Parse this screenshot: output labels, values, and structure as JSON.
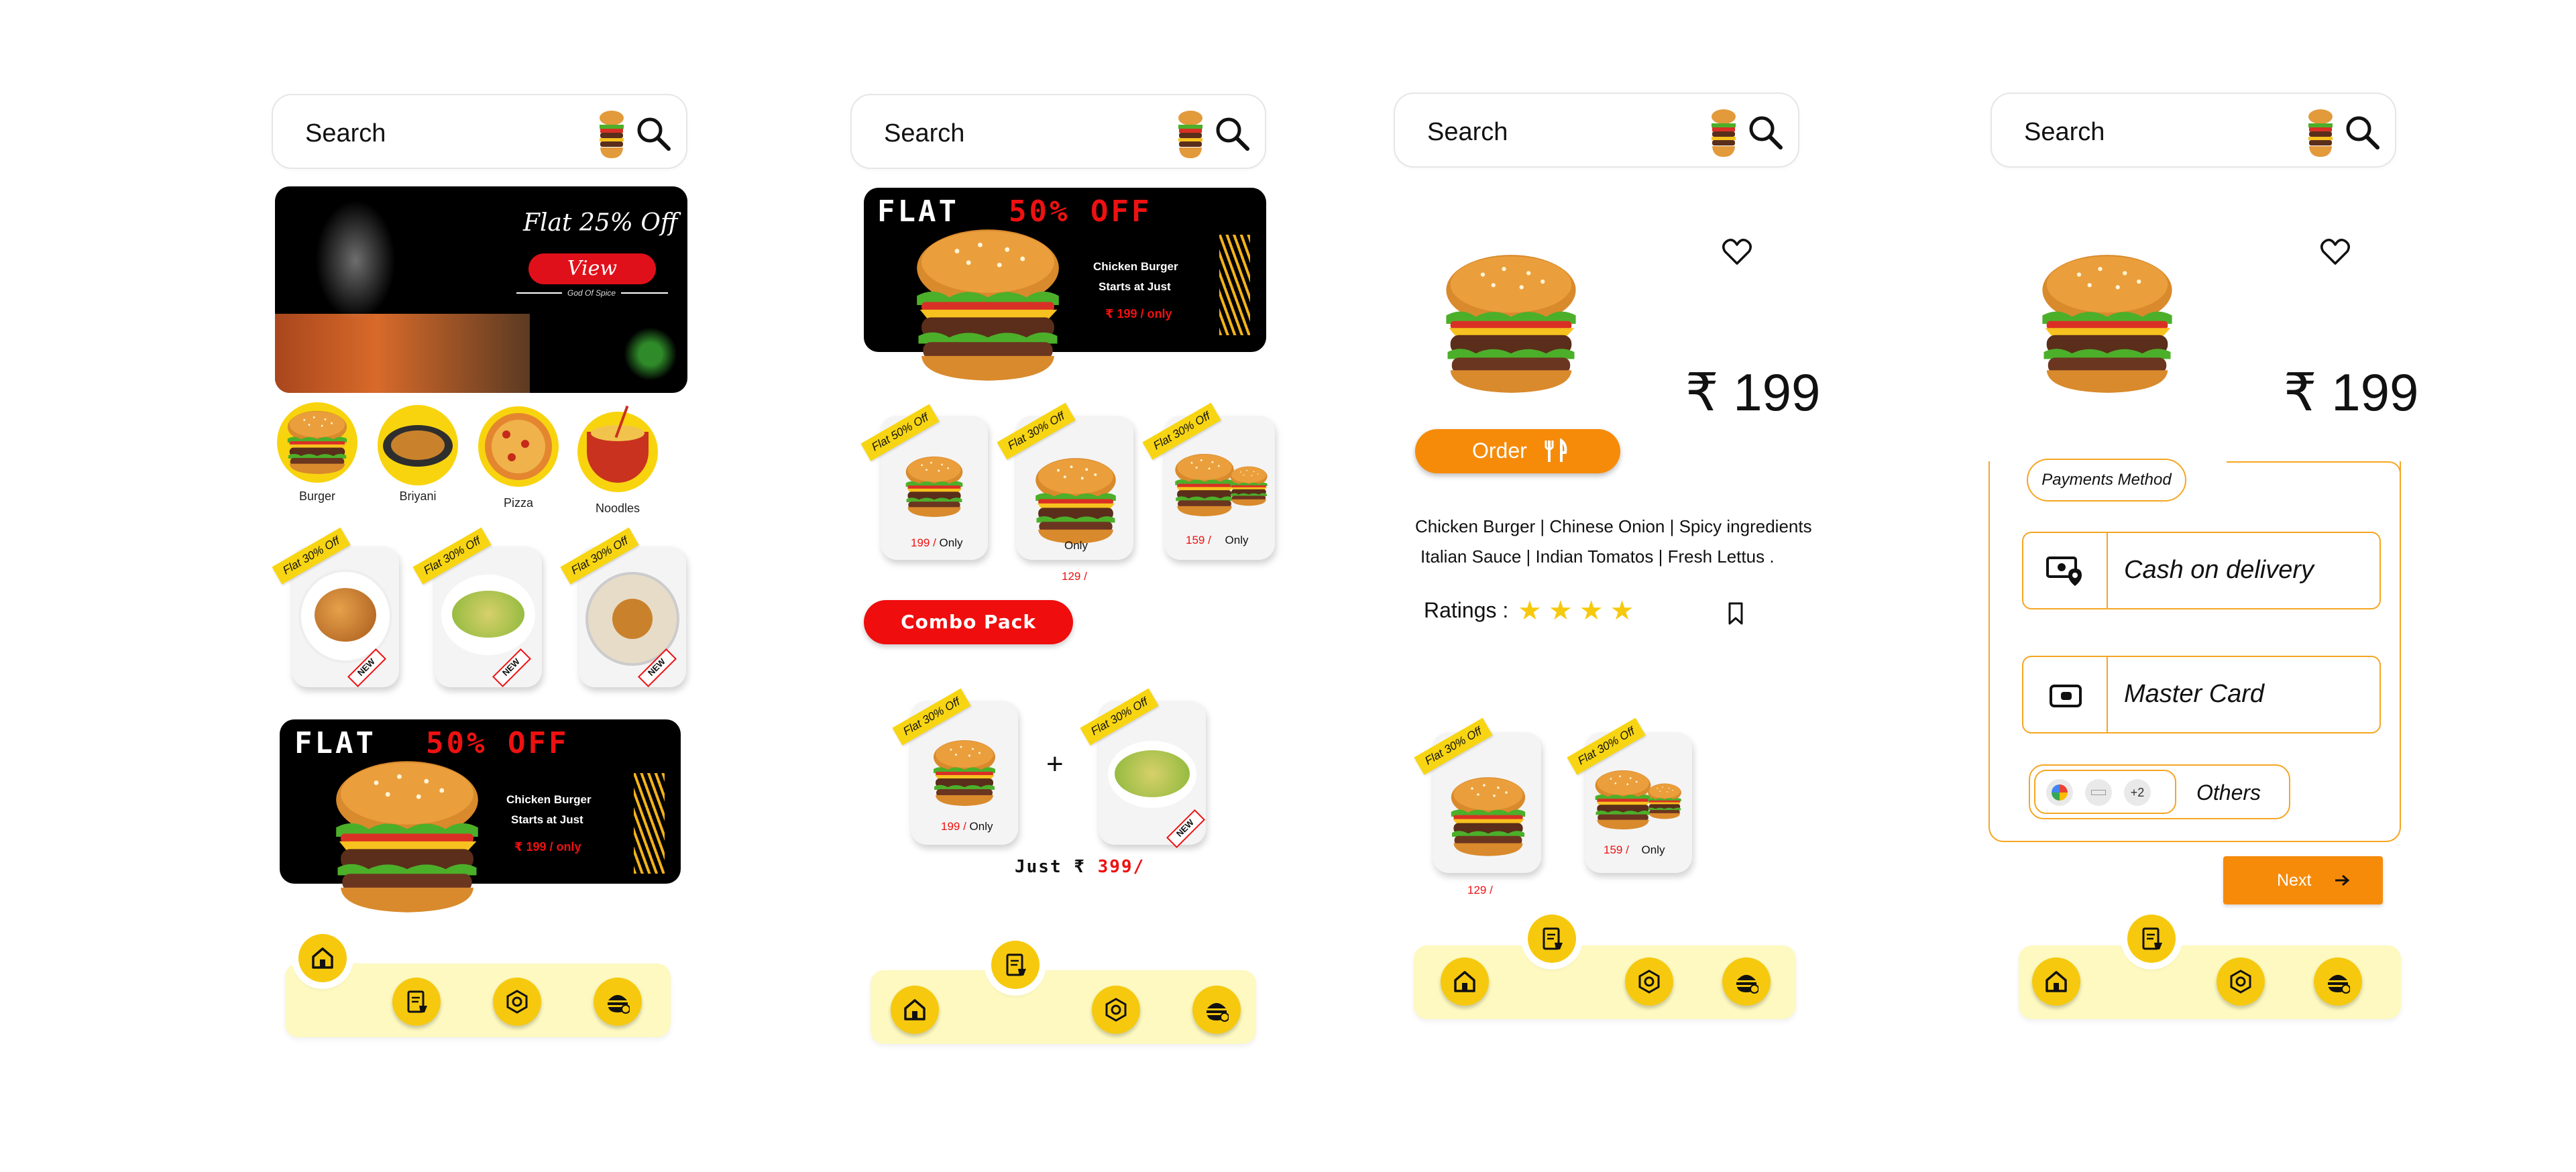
{
  "search_placeholder": "Search",
  "screen1": {
    "banner_top": {
      "headline": "Flat 25% Off",
      "button": "View",
      "tagline": "God Of Spice"
    },
    "categories": [
      {
        "label": "Burger"
      },
      {
        "label": "Briyani"
      },
      {
        "label": "Pizza"
      },
      {
        "label": "Noodles"
      }
    ],
    "offer_tag": "Flat 30% Off",
    "new_ribbon": "NEW",
    "banner_bottom": {
      "flat": "FLAT",
      "pct": "50% OFF",
      "line1": "Chicken Burger",
      "line2": "Starts at  Just",
      "price": "₹ 199 / only"
    }
  },
  "screen2": {
    "banner": {
      "flat": "FLAT",
      "pct": "50% OFF",
      "line1": "Chicken Burger",
      "line2": "Starts at  Just",
      "price": "₹ 199 / only"
    },
    "cards": [
      {
        "tag": "Flat 50% Off",
        "price": "199 /",
        "suffix": "Only"
      },
      {
        "tag": "Flat 30% Off",
        "price": "129 /",
        "suffix": "Only"
      },
      {
        "tag": "Flat 30% Off",
        "price": "159 /",
        "suffix": "Only"
      }
    ],
    "combo_button": "Combo Pack",
    "combo_cards": [
      {
        "tag": "Flat 30% Off",
        "price": "199 /",
        "suffix": "Only"
      },
      {
        "tag": "Flat 30% Off",
        "ribbon": "NEW"
      }
    ],
    "plus": "+",
    "just_label": "Just ₹",
    "just_price": "399/"
  },
  "screen3": {
    "price": "₹ 199",
    "order_button": "Order",
    "ingredients_1": "Chicken Burger | Chinese Onion | Spicy ingredients",
    "ingredients_2": "Italian Sauce | Indian Tomatos | Fresh Lettus .",
    "ratings_label": "Ratings :",
    "rating": 4,
    "cards": [
      {
        "tag": "Flat 30% Off",
        "price": "129 /"
      },
      {
        "tag": "Flat 30% Off",
        "price": "159 /",
        "suffix": "Only"
      }
    ]
  },
  "screen4": {
    "price": "₹ 199",
    "payments_label": "Payments Method",
    "options": [
      {
        "label": "Cash on delivery",
        "icon": "cash-location-icon"
      },
      {
        "label": "Master Card",
        "icon": "card-icon"
      }
    ],
    "others_badge": "+2",
    "others_label": "Others",
    "next_button": "Next"
  },
  "nav_icons": [
    "home-icon",
    "orders-icon",
    "settings-icon",
    "menu-icon"
  ],
  "colors": {
    "yellow": "#f6c90e",
    "orange": "#f68b0a",
    "red": "#e11d1d",
    "nav_bg": "#fdf9c0"
  }
}
